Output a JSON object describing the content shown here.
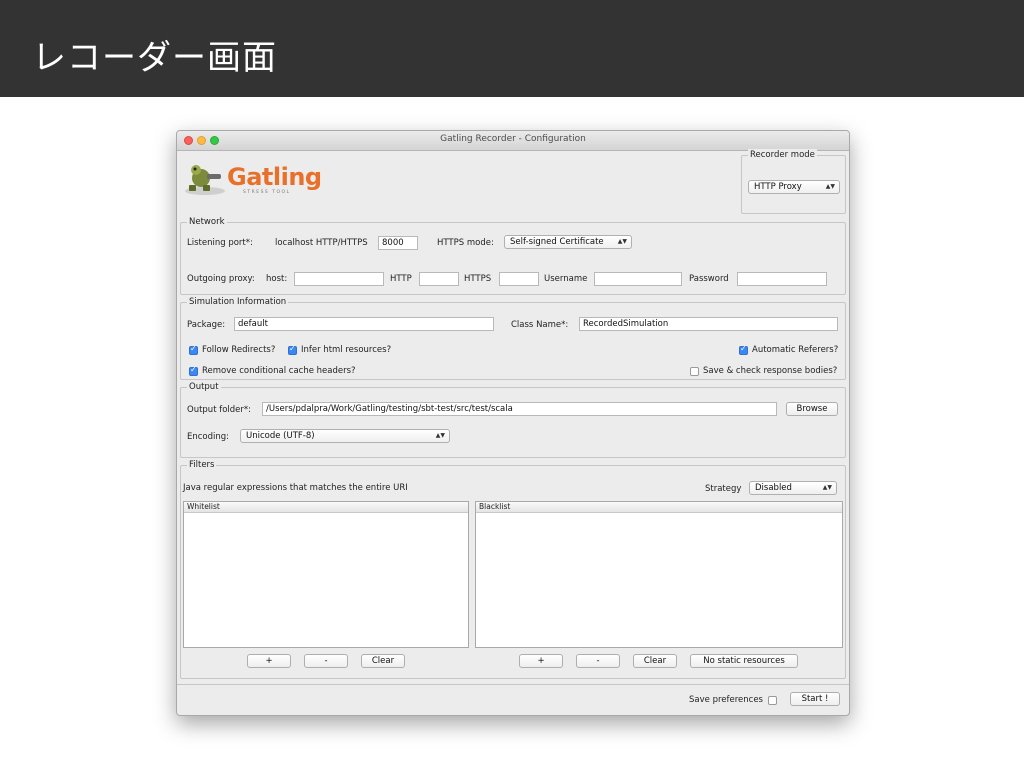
{
  "slide": {
    "title": "レコーダー画面"
  },
  "window": {
    "title": "Gatling Recorder - Configuration"
  },
  "logo": {
    "brand": "Gatling",
    "tagline": "STRESS TOOL",
    "accent_color": "#e8702a"
  },
  "recorder_mode": {
    "legend": "Recorder mode",
    "value": "HTTP Proxy"
  },
  "network": {
    "legend": "Network",
    "listening_port_label": "Listening port*:",
    "localhost_label": "localhost HTTP/HTTPS",
    "port_value": "8000",
    "https_mode_label": "HTTPS mode:",
    "https_mode_value": "Self-signed Certificate",
    "outgoing_proxy_label": "Outgoing proxy:",
    "host_label": "host:",
    "host_value": "",
    "http_label": "HTTP",
    "http_value": "",
    "https_label": "HTTPS",
    "https_value": "",
    "username_label": "Username",
    "username_value": "",
    "password_label": "Password",
    "password_value": ""
  },
  "simulation": {
    "legend": "Simulation Information",
    "package_label": "Package:",
    "package_value": "default",
    "class_label": "Class Name*:",
    "class_value": "RecordedSimulation",
    "follow_redirects": "Follow Redirects?",
    "infer_html": "Infer html resources?",
    "automatic_referers": "Automatic Referers?",
    "remove_cache_headers": "Remove conditional cache headers?",
    "save_check_bodies": "Save & check response bodies?"
  },
  "output": {
    "legend": "Output",
    "folder_label": "Output folder*:",
    "folder_value": "/Users/pdalpra/Work/Gatling/testing/sbt-test/src/test/scala",
    "browse": "Browse",
    "encoding_label": "Encoding:",
    "encoding_value": "Unicode (UTF-8)"
  },
  "filters": {
    "legend": "Filters",
    "description": "Java regular expressions that matches the entire URI",
    "strategy_label": "Strategy",
    "strategy_value": "Disabled",
    "whitelist_header": "Whitelist",
    "blacklist_header": "Blacklist",
    "add": "+",
    "remove": "-",
    "clear": "Clear",
    "no_static": "No static resources"
  },
  "footer": {
    "save_preferences": "Save preferences",
    "start": "Start !"
  }
}
